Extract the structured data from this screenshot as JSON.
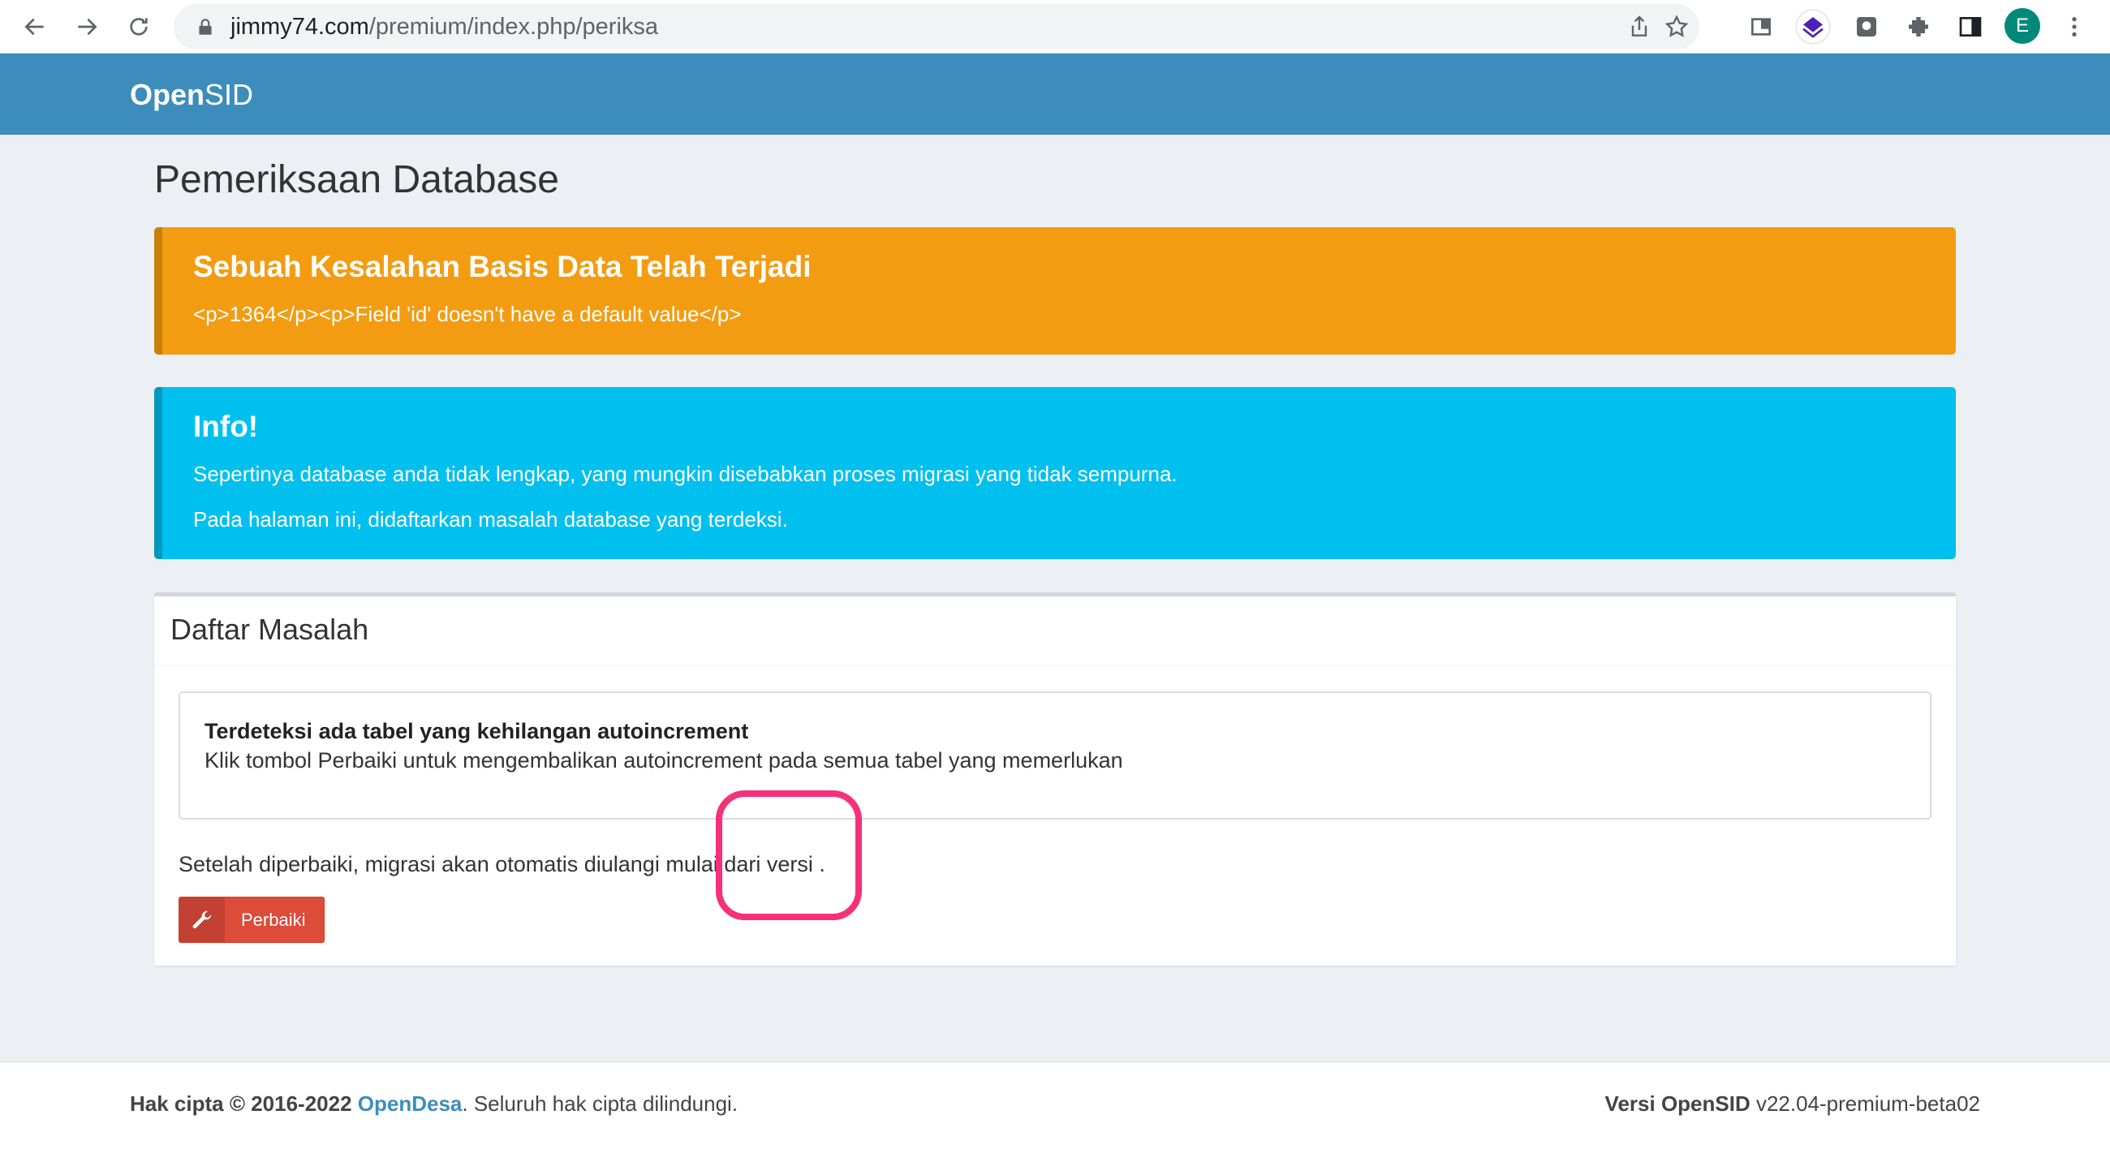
{
  "browser": {
    "url_host": "jimmy74.com",
    "url_path": "/premium/index.php/periksa",
    "profile_initial": "E"
  },
  "app": {
    "brand_bold": "Open",
    "brand_rest": "SID"
  },
  "page": {
    "title": "Pemeriksaan Database"
  },
  "error_callout": {
    "title": "Sebuah Kesalahan Basis Data Telah Terjadi",
    "message": "<p>1364</p><p>Field 'id' doesn't have a default value</p>"
  },
  "info_callout": {
    "title": "Info!",
    "line1": "Sepertinya database anda tidak lengkap, yang mungkin disebabkan proses migrasi yang tidak sempurna.",
    "line2": "Pada halaman ini, didaftarkan masalah database yang terdeksi."
  },
  "problem_box": {
    "title": "Daftar Masalah",
    "problem_title": "Terdeteksi ada tabel yang kehilangan autoincrement",
    "problem_desc": "Klik tombol Perbaiki untuk mengembalikan autoincrement pada semua tabel yang memerlukan",
    "note": "Setelah diperbaiki, migrasi akan otomatis diulangi mulai dari versi .",
    "fix_button": "Perbaiki"
  },
  "footer": {
    "copyright_prefix": "Hak cipta © 2016-2022",
    "link": "OpenDesa",
    "copyright_suffix": ". Seluruh hak cipta dilindungi.",
    "version_label": "Versi OpenSID",
    "version_value": " v22.04-premium-beta02"
  },
  "colors": {
    "header": "#3c8dbc",
    "warning": "#f39c12",
    "info": "#00c0ef",
    "danger": "#dd4b39",
    "highlight": "#f5317a"
  }
}
